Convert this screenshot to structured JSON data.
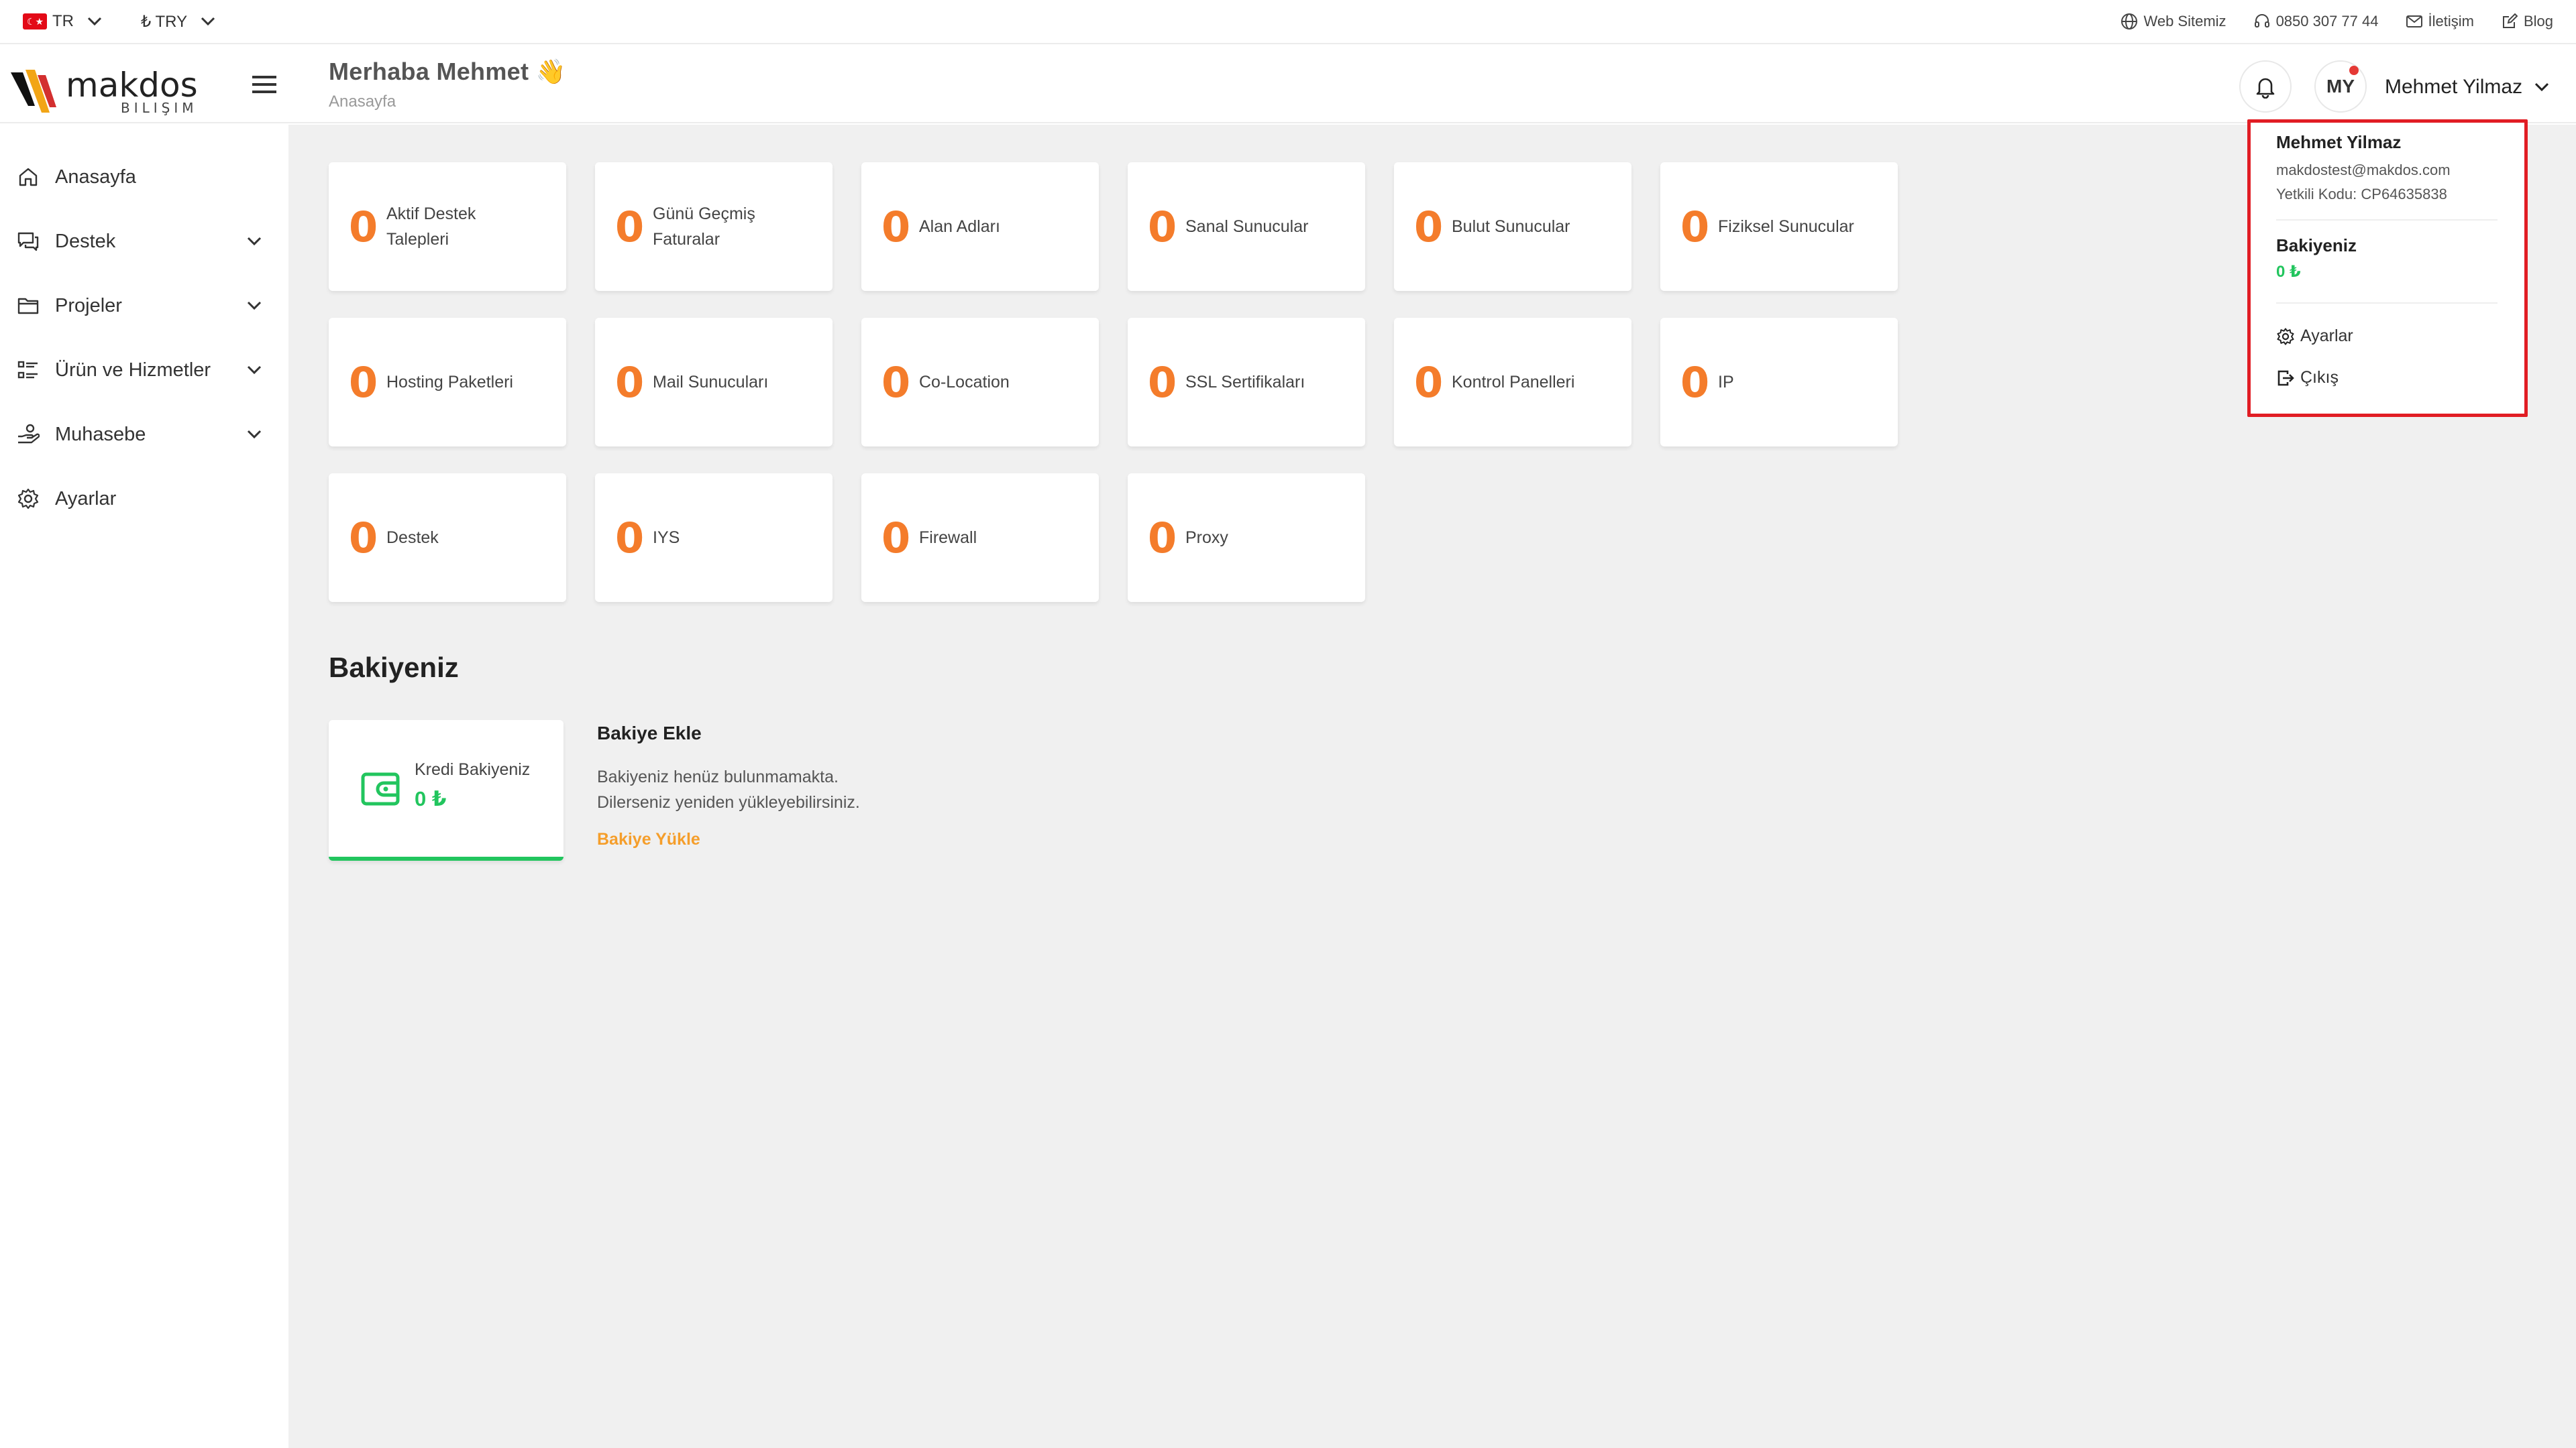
{
  "topbar": {
    "language": "TR",
    "currency": "₺ TRY",
    "links": [
      {
        "label": "Web Sitemiz",
        "icon": "globe-icon"
      },
      {
        "label": "0850 307 77 44",
        "icon": "headset-icon"
      },
      {
        "label": "İletişim",
        "icon": "mail-icon"
      },
      {
        "label": "Blog",
        "icon": "edit-icon"
      }
    ]
  },
  "header": {
    "logo_text": "makdos",
    "logo_subtext": "BILIŞIM",
    "greeting": "Merhaba Mehmet 👋",
    "breadcrumb": "Anasayfa",
    "avatar_initials": "MY",
    "user_name": "Mehmet Yilmaz"
  },
  "sidebar": {
    "items": [
      {
        "label": "Anasayfa",
        "icon": "home-icon",
        "has_caret": false
      },
      {
        "label": "Destek",
        "icon": "chat-icon",
        "has_caret": true
      },
      {
        "label": "Projeler",
        "icon": "folder-icon",
        "has_caret": true
      },
      {
        "label": "Ürün ve Hizmetler",
        "icon": "list-icon",
        "has_caret": true
      },
      {
        "label": "Muhasebe",
        "icon": "hand-coins-icon",
        "has_caret": true
      },
      {
        "label": "Ayarlar",
        "icon": "gear-icon",
        "has_caret": false
      }
    ]
  },
  "stats": [
    {
      "value": "0",
      "label": "Aktif Destek Talepleri"
    },
    {
      "value": "0",
      "label": "Günü Geçmiş Faturalar"
    },
    {
      "value": "0",
      "label": "Alan Adları"
    },
    {
      "value": "0",
      "label": "Sanal Sunucular"
    },
    {
      "value": "0",
      "label": "Bulut Sunucular"
    },
    {
      "value": "0",
      "label": "Fiziksel Sunucular"
    },
    {
      "value": "0",
      "label": "Hosting Paketleri"
    },
    {
      "value": "0",
      "label": "Mail Sunucuları"
    },
    {
      "value": "0",
      "label": "Co-Location"
    },
    {
      "value": "0",
      "label": "SSL Sertifikaları"
    },
    {
      "value": "0",
      "label": "Kontrol Panelleri"
    },
    {
      "value": "0",
      "label": "IP"
    },
    {
      "value": "0",
      "label": "Destek"
    },
    {
      "value": "0",
      "label": "IYS"
    },
    {
      "value": "0",
      "label": "Firewall"
    },
    {
      "value": "0",
      "label": "Proxy"
    }
  ],
  "balance": {
    "section_title": "Bakiyeniz",
    "credit_label": "Kredi Bakiyeniz",
    "credit_value": "0 ₺",
    "add_title": "Bakiye Ekle",
    "add_line1": "Bakiyeniz henüz bulunmamakta.",
    "add_line2": "Dilerseniz yeniden yükleyebilirsiniz.",
    "add_link": "Bakiye Yükle"
  },
  "dropdown": {
    "name": "Mehmet Yilmaz",
    "email": "makdostest@makdos.com",
    "auth_code": "Yetkili Kodu: CP64635838",
    "balance_label": "Bakiyeniz",
    "balance_value": "0 ₺",
    "settings_label": "Ayarlar",
    "logout_label": "Çıkış"
  },
  "colors": {
    "accent_orange": "#f47c2b",
    "success_green": "#22c55e",
    "highlight_red": "#e11d24",
    "background": "#f0f0f0"
  }
}
